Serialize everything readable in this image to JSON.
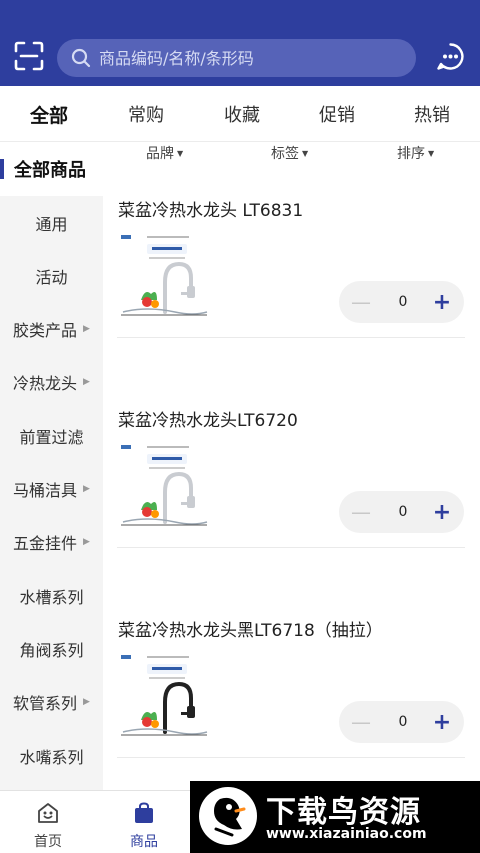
{
  "header": {
    "search": {
      "placeholder": "商品编码/名称/条形码"
    }
  },
  "tabs": [
    {
      "label": "全部",
      "active": true
    },
    {
      "label": "常购",
      "active": false
    },
    {
      "label": "收藏",
      "active": false
    },
    {
      "label": "促销",
      "active": false
    },
    {
      "label": "热销",
      "active": false
    }
  ],
  "sidebar": {
    "title": "全部商品",
    "items": [
      {
        "label": "通用",
        "has_arrow": false
      },
      {
        "label": "活动",
        "has_arrow": false
      },
      {
        "label": "胶类产品",
        "has_arrow": true
      },
      {
        "label": "冷热龙头",
        "has_arrow": true
      },
      {
        "label": "前置过滤",
        "has_arrow": false
      },
      {
        "label": "马桶洁具",
        "has_arrow": true
      },
      {
        "label": "五金挂件",
        "has_arrow": true
      },
      {
        "label": "水槽系列",
        "has_arrow": false
      },
      {
        "label": "角阀系列",
        "has_arrow": false
      },
      {
        "label": "软管系列",
        "has_arrow": true
      },
      {
        "label": "水嘴系列",
        "has_arrow": false
      }
    ]
  },
  "filters": [
    {
      "label": "品牌"
    },
    {
      "label": "标签"
    },
    {
      "label": "排序"
    }
  ],
  "products": [
    {
      "name": "菜盆冷热水龙头 LT6831",
      "qty": "0",
      "faucet_color": "#c9ccd1"
    },
    {
      "name": "菜盆冷热水龙头LT6720",
      "qty": "0",
      "faucet_color": "#c9ccd1"
    },
    {
      "name": "菜盆冷热水龙头黑LT6718（抽拉）",
      "qty": "0",
      "faucet_color": "#222222"
    }
  ],
  "bottom_nav": [
    {
      "label": "首页",
      "icon": "home-icon",
      "active": false
    },
    {
      "label": "商品",
      "icon": "bag-icon",
      "active": true
    }
  ],
  "watermark": {
    "title": "下载鸟资源",
    "url": "www.xiazainiao.com"
  },
  "colors": {
    "brand": "#2e3e9e",
    "sidebar_bg": "#f4f4f4",
    "stepper_bg": "#f1f1f1"
  }
}
